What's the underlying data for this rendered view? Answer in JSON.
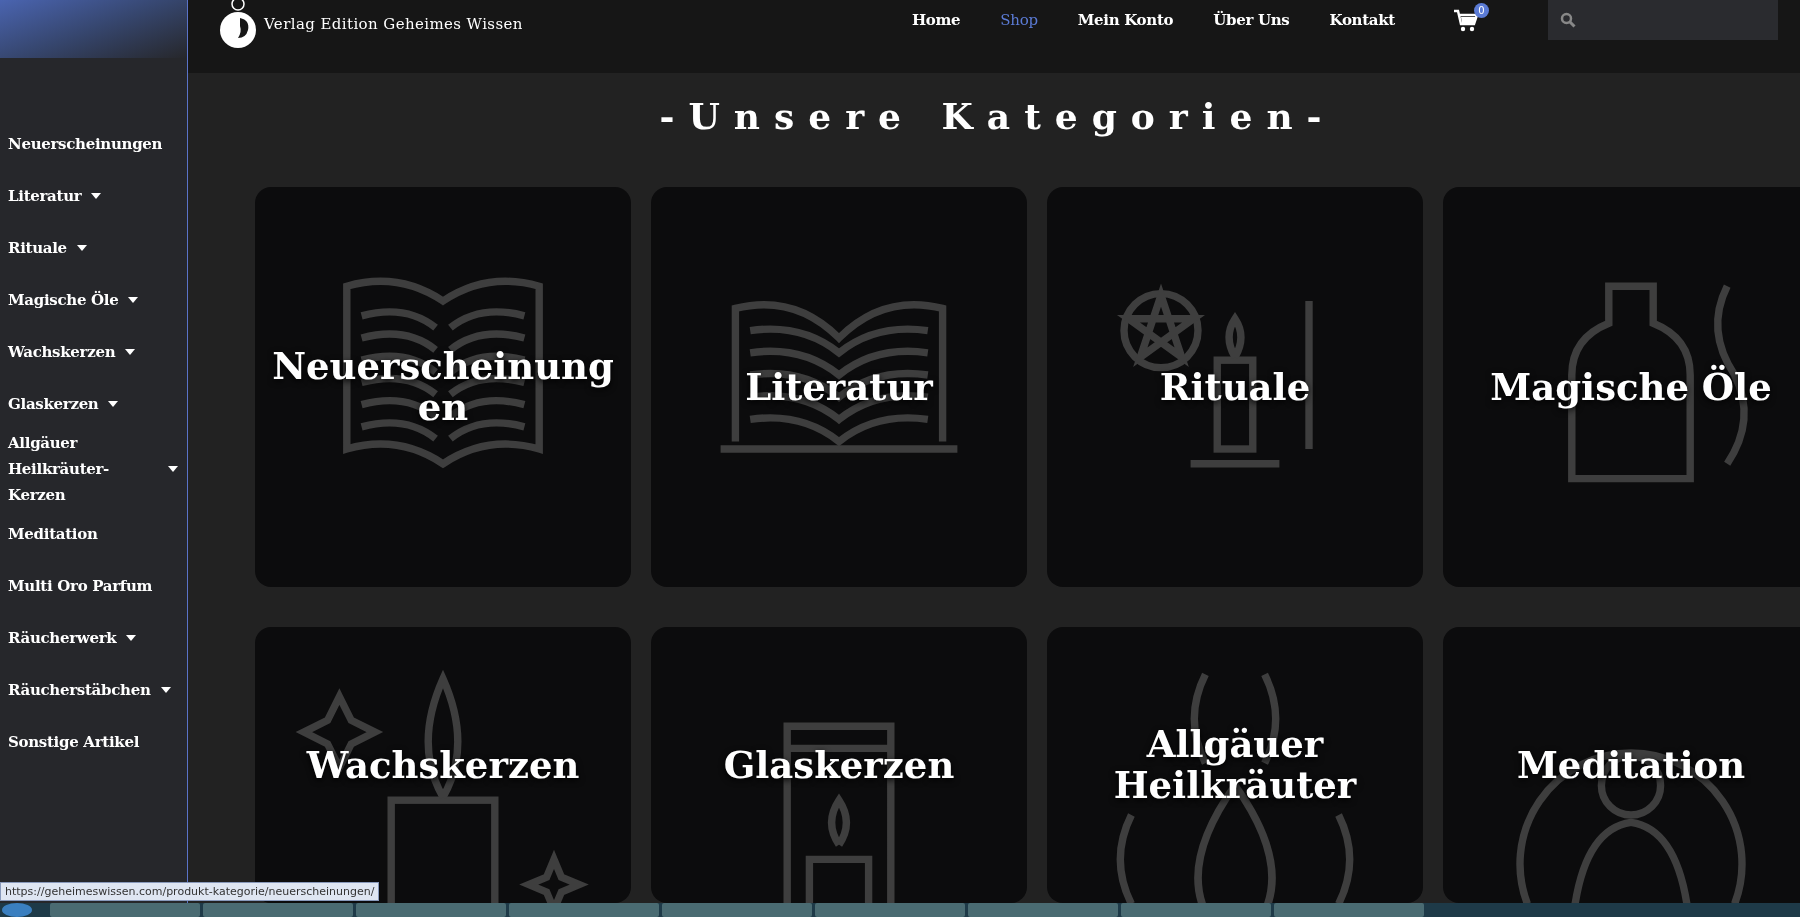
{
  "brand": {
    "name": "Verlag Edition Geheimes Wissen"
  },
  "nav": [
    {
      "label": "Home",
      "selected": false
    },
    {
      "label": "Shop",
      "selected": true
    },
    {
      "label": "Mein Konto",
      "selected": false
    },
    {
      "label": "Über Uns",
      "selected": false
    },
    {
      "label": "Kontakt",
      "selected": false
    }
  ],
  "cart": {
    "count": "0"
  },
  "sidebar": {
    "items": [
      {
        "label": "Neuerscheinungen",
        "has_submenu": false
      },
      {
        "label": "Literatur",
        "has_submenu": true
      },
      {
        "label": "Rituale",
        "has_submenu": true
      },
      {
        "label": "Magische Öle",
        "has_submenu": true
      },
      {
        "label": "Wachskerzen",
        "has_submenu": true
      },
      {
        "label": "Glaskerzen",
        "has_submenu": true
      },
      {
        "label": "Allgäuer Heilkräuter-Kerzen",
        "has_submenu": true
      },
      {
        "label": "Meditation",
        "has_submenu": false
      },
      {
        "label": "Multi Oro Parfum",
        "has_submenu": false
      },
      {
        "label": "Räucherwerk",
        "has_submenu": true
      },
      {
        "label": "Räucherstäbchen",
        "has_submenu": true
      },
      {
        "label": "Sonstige Artikel",
        "has_submenu": false
      }
    ]
  },
  "heading": "-Unsere Kategorien-",
  "categories": [
    {
      "title": "Neuerscheinungen",
      "kind": "book"
    },
    {
      "title": "Literatur",
      "kind": "book-open"
    },
    {
      "title": "Rituale",
      "kind": "ritual"
    },
    {
      "title": "Magische Öle",
      "kind": "bottle"
    },
    {
      "title": "Wachskerzen",
      "kind": "candle"
    },
    {
      "title": "Glaskerzen",
      "kind": "jar"
    },
    {
      "title": "Allgäuer Heilkräuter",
      "kind": "flame"
    },
    {
      "title": "Meditation",
      "kind": "person"
    }
  ],
  "status_url": "https://geheimeswissen.com/produkt-kategorie/neuerscheinungen/"
}
